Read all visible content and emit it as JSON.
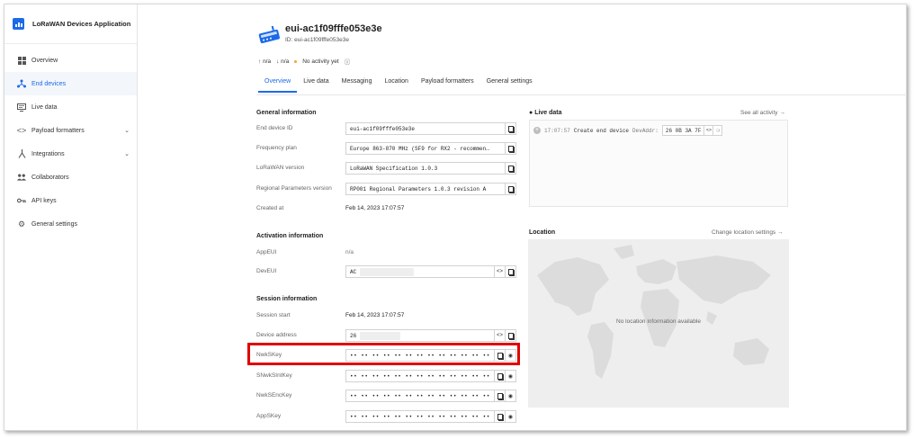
{
  "app": {
    "title": "LoRaWAN Devices Application"
  },
  "sidebar": {
    "items": [
      {
        "label": "Overview",
        "icon": "grid-icon"
      },
      {
        "label": "End devices",
        "icon": "devices-icon",
        "active": true
      },
      {
        "label": "Live data",
        "icon": "monitor-icon"
      },
      {
        "label": "Payload formatters",
        "icon": "code-icon",
        "expandable": true
      },
      {
        "label": "Integrations",
        "icon": "integration-icon",
        "expandable": true
      },
      {
        "label": "Collaborators",
        "icon": "people-icon"
      },
      {
        "label": "API keys",
        "icon": "key-icon"
      },
      {
        "label": "General settings",
        "icon": "gear-icon"
      }
    ]
  },
  "device": {
    "title": "eui-ac1f09fffe053e3e",
    "id_line": "ID: eui-ac1f09fffe053e3e",
    "uplink": "n/a",
    "downlink": "n/a",
    "activity": "No activity yet"
  },
  "tabs": [
    "Overview",
    "Live data",
    "Messaging",
    "Location",
    "Payload formatters",
    "General settings"
  ],
  "general": {
    "title": "General information",
    "end_device_id_label": "End device ID",
    "end_device_id": "eui-ac1f09fffe053e3e",
    "frequency_plan_label": "Frequency plan",
    "frequency_plan": "Europe 863-870 MHz (SF9 for RX2 - recommen…",
    "lorawan_version_label": "LoRaWAN version",
    "lorawan_version": "LoRaWAN Specification 1.0.3",
    "regional_label": "Regional Parameters version",
    "regional": "RP001 Regional Parameters 1.0.3 revision A",
    "created_label": "Created at",
    "created": "Feb 14, 2023 17:07:57"
  },
  "activation": {
    "title": "Activation information",
    "appeui_label": "AppEUI",
    "appeui": "n/a",
    "deveui_label": "DevEUI",
    "deveui_prefix": "AC"
  },
  "session": {
    "title": "Session information",
    "start_label": "Session start",
    "start": "Feb 14, 2023 17:07:57",
    "address_label": "Device address",
    "address_prefix": "26",
    "nwkskey_label": "NwkSKey",
    "snwksintkey_label": "SNwkSIntKey",
    "nwksenckey_label": "NwkSEncKey",
    "appskey_label": "AppSKey",
    "masked": "•• •• •• •• •• •• •• •• •• •• •• •• •• •• •• ••"
  },
  "live_data": {
    "title": "Live data",
    "see_all": "See all activity →",
    "time": "17:07:57",
    "event": "Create end device",
    "attr_label": "DevAddr:",
    "attr_value": "26 0B 3A 7F"
  },
  "location": {
    "title": "Location",
    "change": "Change location settings →",
    "empty": "No location information available"
  },
  "colors": {
    "accent": "#1c6ae8",
    "highlight": "#e00000",
    "activity_dot": "#f4a52a"
  }
}
